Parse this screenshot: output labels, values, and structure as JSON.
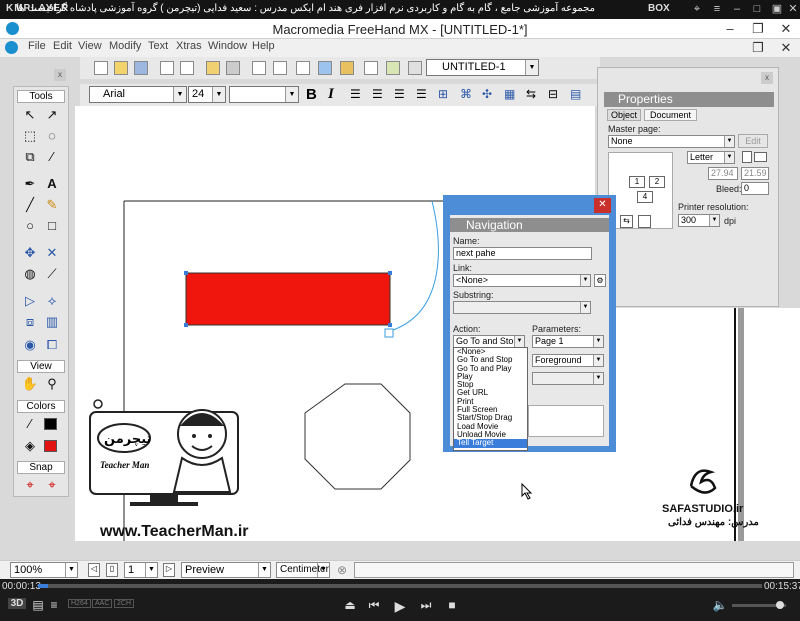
{
  "player": {
    "logo": "KMPLAYER",
    "caption": "مجموعه آموزشی جامع ، گام به گام و کاربردی نرم افزار فری هند ام ایکس  مدرس : سعید فدایی (تیچرمن ) گروه آموزشی پادشاه گرافیست ها",
    "box_label": "BOX",
    "time_elapsed": "00:00:13",
    "time_total": "00:15:37",
    "badges": [
      "H264",
      "AAC",
      "2CH"
    ]
  },
  "app": {
    "title": "Macromedia FreeHand MX - [UNTITLED-1*]",
    "menu": [
      "File",
      "Edit",
      "View",
      "Modify",
      "Text",
      "Xtras",
      "Window",
      "Help"
    ]
  },
  "toolbar": {
    "document_select": "UNTITLED-1",
    "font": "Arial",
    "font_size": "24",
    "style": ""
  },
  "tools_panel": {
    "sections": [
      "Tools",
      "View",
      "Colors",
      "Snap"
    ]
  },
  "properties": {
    "title": "Properties",
    "tabs": [
      "Object",
      "Document"
    ],
    "master_page_label": "Master page:",
    "master_page_value": "None",
    "edit_button": "Edit",
    "page_size": "Letter",
    "width": "27.94",
    "height": "21.59",
    "bleed_label": "Bleed:",
    "bleed_value": "0",
    "pages": [
      "1",
      "2",
      "4"
    ],
    "printer_resolution_label": "Printer resolution:",
    "printer_resolution_value": "300",
    "dpi_label": "dpi"
  },
  "navigation": {
    "title": "Navigation",
    "name_label": "Name:",
    "name_value": "next pahe",
    "link_label": "Link:",
    "link_value": "<None>",
    "substring_label": "Substring:",
    "action_label": "Action:",
    "action_value": "Go To and Stop",
    "parameters_label": "Parameters:",
    "param1_value": "Page 1",
    "param2_value": "Foreground",
    "action_options": [
      "<None>",
      "Go To and Stop",
      "Go To and Play",
      "Play",
      "Stop",
      "Get URL",
      "Print",
      "Full Screen",
      "Start/Stop Drag",
      "Load Movie",
      "Unload Movie",
      "Tell Target"
    ],
    "selected_option_index": 11
  },
  "statusbar": {
    "zoom": "100%",
    "page": "1",
    "view_mode": "Preview",
    "units": "Centimeter"
  },
  "watermark": {
    "url": "www.TeacherMan.ir",
    "logo_text": "تیچرمن",
    "logo_subtitle": "Teacher Man",
    "studio": "SAFASTUDIO.ir",
    "tutor": "مدرس: مهندس فدائی"
  },
  "colors": {
    "red_rect": "#f0150d",
    "nav_frame": "#4d8dd8",
    "fill_swatch": "#e01212"
  }
}
